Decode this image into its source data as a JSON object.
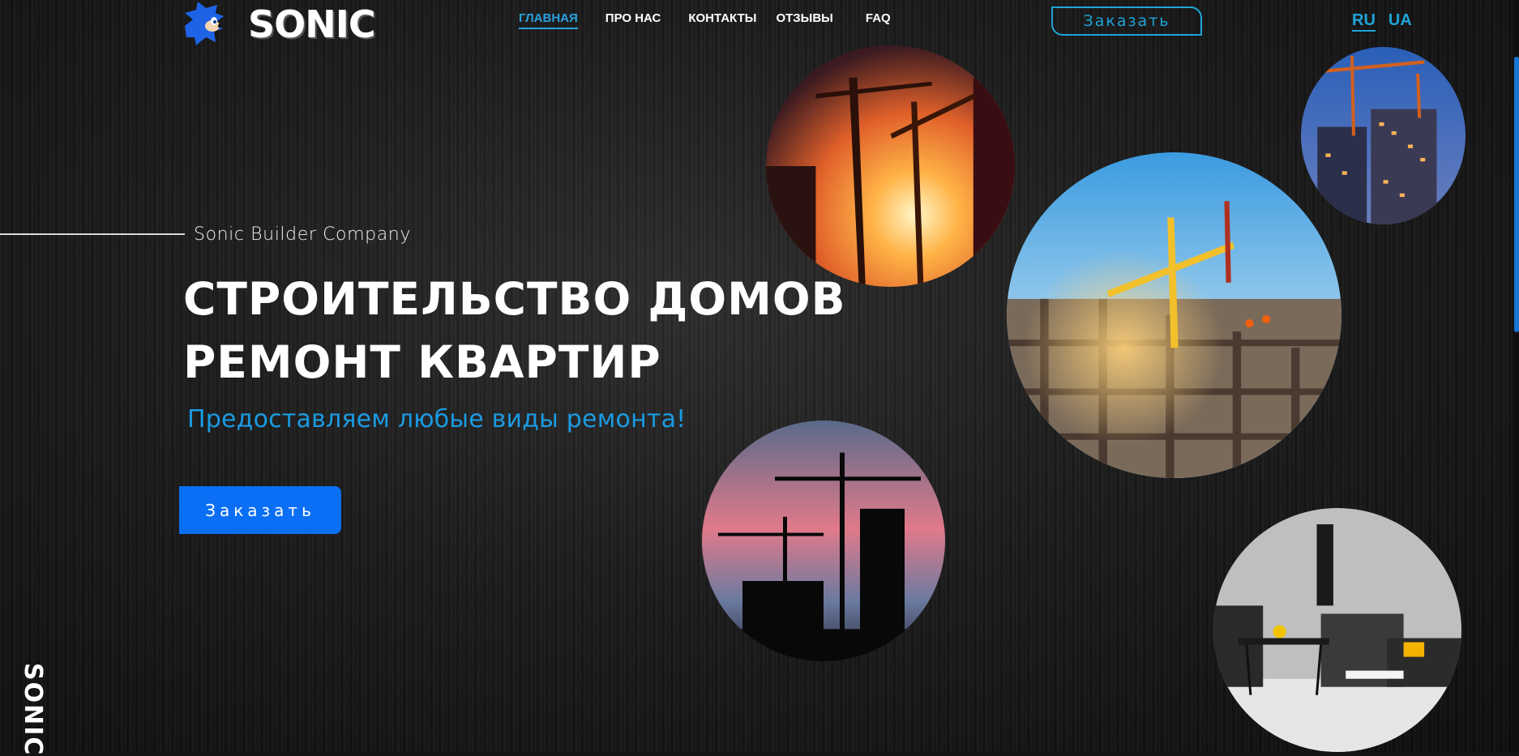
{
  "header": {
    "logo": {
      "icon": "hedgehog-logo-icon",
      "text": "SONIC"
    },
    "nav": [
      {
        "label": "ГЛАВНАЯ",
        "active": true
      },
      {
        "label": "ПРО НАС",
        "active": false
      },
      {
        "label": "КОНТАКТЫ",
        "active": false
      },
      {
        "label": "ОТЗЫВЫ",
        "active": false
      },
      {
        "label": "FAQ",
        "active": false
      }
    ],
    "order_button": "Заказать",
    "languages": [
      {
        "label": "RU",
        "active": true
      },
      {
        "label": "UA",
        "active": false
      }
    ]
  },
  "hero": {
    "subtitle": "Sonic Builder Company",
    "title_line1": "СТРОИТЕЛЬСТВО ДОМОВ",
    "title_line2": "РЕМОНТ КВАРТИР",
    "tagline": "Предоставляем любые виды ремонта!",
    "order_button": "Заказать"
  },
  "side_brand": "SONIC",
  "gallery": [
    {
      "name": "cranes-sunset-photo"
    },
    {
      "name": "construction-night-photo"
    },
    {
      "name": "building-construction-photo"
    },
    {
      "name": "cranes-silhouette-photo"
    },
    {
      "name": "modern-interior-photo"
    }
  ],
  "colors": {
    "accent": "#1fa4d8",
    "primary_button": "#0a6ff4",
    "tagline": "#1a9be2",
    "background": "#141414"
  }
}
